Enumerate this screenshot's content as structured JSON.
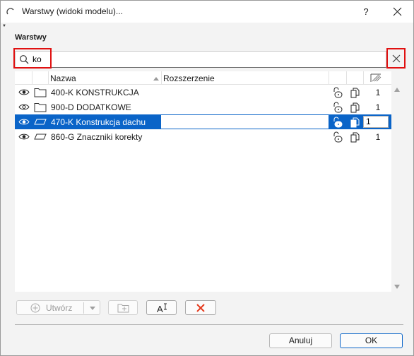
{
  "window": {
    "title": "Warstwy (widoki modelu)...",
    "help": "?"
  },
  "section_label": "Warstwy",
  "search": {
    "value": "ko",
    "placeholder": ""
  },
  "table": {
    "headers": {
      "name": "Nazwa",
      "extension": "Rozszerzenie"
    },
    "rows": [
      {
        "name": "400-K KONSTRUKCJA",
        "number": "1",
        "type": "folder",
        "selected": false
      },
      {
        "name": "900-D DODATKOWE",
        "number": "1",
        "type": "folder",
        "selected": false
      },
      {
        "name": "470-K Konstrukcja dachu",
        "number": "1",
        "type": "layer",
        "selected": true
      },
      {
        "name": "860-G Znaczniki korekty",
        "number": "1",
        "type": "layer",
        "selected": false
      }
    ]
  },
  "buttons": {
    "create": "Utwórz",
    "rename_icon": "rename-icon",
    "delete_icon": "delete-x-icon",
    "cancel": "Anuluj",
    "ok": "OK"
  },
  "colors": {
    "selection": "#0a64c8",
    "highlight": "#e01010",
    "delete": "#e53b1e"
  }
}
